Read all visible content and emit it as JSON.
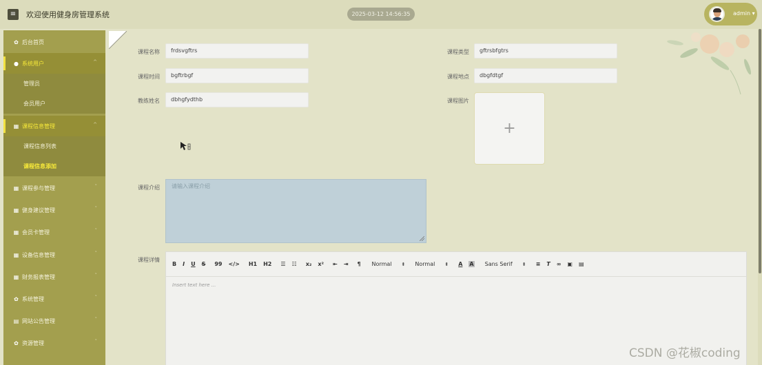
{
  "header": {
    "menu_icon": "hamburger-icon",
    "title": "欢迎使用健身房管理系统",
    "datetime": "2025-03-12 14:56:35",
    "user": "admin",
    "user_caret": "▾"
  },
  "sidebar": {
    "home": {
      "label": "后台首页",
      "icon": "gear-icon"
    },
    "system_users": {
      "label": "系统用户",
      "icon": "user-icon",
      "sub": [
        "管理员",
        "会员用户"
      ]
    },
    "course_info": {
      "label": "课程信息管理",
      "icon": "grid-icon",
      "sub": [
        "课程信息列表",
        "课程信息添加"
      ]
    },
    "items": [
      {
        "label": "课程参与管理",
        "icon": "grid-icon"
      },
      {
        "label": "健身建议管理",
        "icon": "grid-icon"
      },
      {
        "label": "会员卡管理",
        "icon": "grid-icon"
      },
      {
        "label": "设备信息管理",
        "icon": "grid-icon"
      },
      {
        "label": "财务报表管理",
        "icon": "grid-icon"
      },
      {
        "label": "系统管理",
        "icon": "gear-icon"
      },
      {
        "label": "网站公告管理",
        "icon": "document-icon"
      },
      {
        "label": "资源管理",
        "icon": "gear-icon"
      }
    ]
  },
  "form": {
    "course_name": {
      "label": "课程名称",
      "value": "frdsvgftrs"
    },
    "course_type": {
      "label": "课程类型",
      "value": "gftrsbfgtrs"
    },
    "course_time": {
      "label": "课程时间",
      "value": "bgftrbgf"
    },
    "course_location": {
      "label": "课程地点",
      "value": "dbgfdtgf"
    },
    "coach_name": {
      "label": "教练姓名",
      "value": "dbhgfydthb"
    },
    "course_image": {
      "label": "课程图片",
      "upload_symbol": "+"
    },
    "course_intro": {
      "label": "课程介绍",
      "placeholder": "请输入课程介绍"
    },
    "course_detail": {
      "label": "课程详情"
    }
  },
  "editor": {
    "buttons": [
      "B",
      "I",
      "U",
      "S",
      "99",
      "</>",
      "H1",
      "H2",
      "☰",
      "☷",
      "x₂",
      "x²",
      "⇤",
      "⇥",
      "¶"
    ],
    "size_select": "Normal",
    "header_select": "Normal",
    "font_select": "Sans Serif",
    "placeholder": "Insert text here ..."
  },
  "watermark": "CSDN @花椒coding",
  "colors": {
    "sidebar": "#a39f4e",
    "sidebar_active": "#8f8b3e",
    "active_text": "#f7e93a",
    "header": "#dcdcbc",
    "background": "#e3e3c8"
  }
}
